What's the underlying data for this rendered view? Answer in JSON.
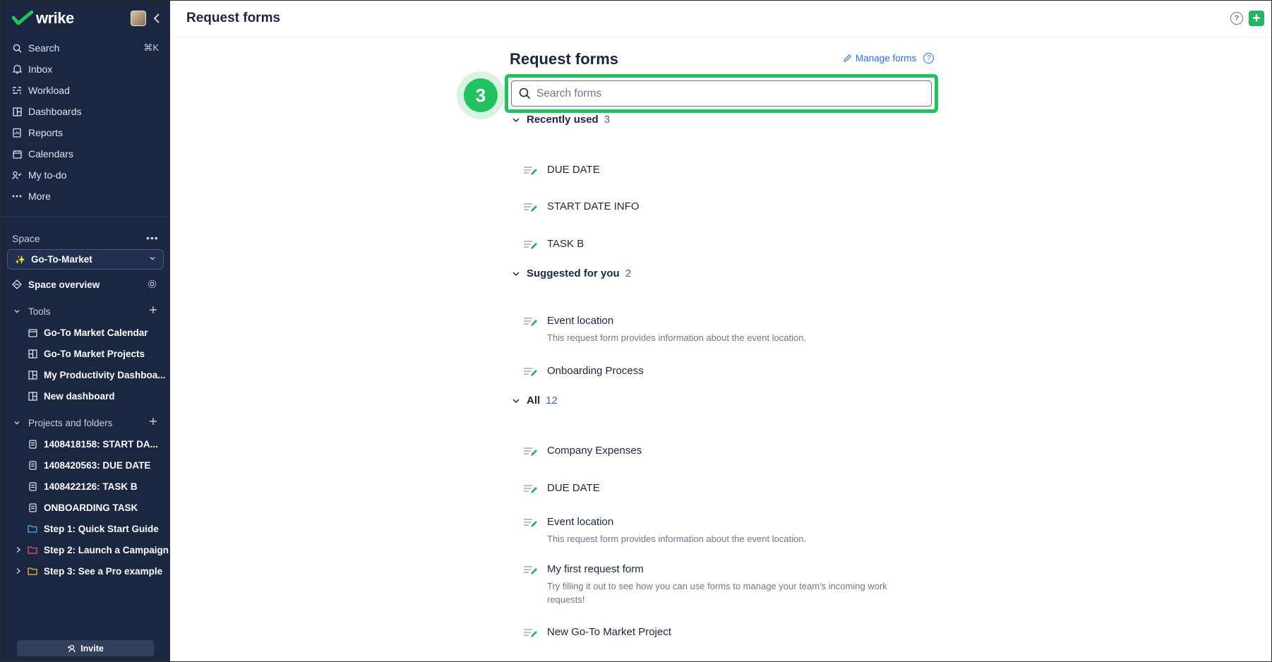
{
  "app": {
    "logo_text": "wrike",
    "colors": {
      "sidebar_bg": "#1b2640",
      "accent_green": "#22c261",
      "link_blue": "#2f6fd6"
    }
  },
  "sidebar": {
    "nav": [
      {
        "label": "Search",
        "icon": "search-icon",
        "shortcut": "⌘K"
      },
      {
        "label": "Inbox",
        "icon": "bell-icon"
      },
      {
        "label": "Workload",
        "icon": "workload-icon"
      },
      {
        "label": "Dashboards",
        "icon": "dashboard-icon"
      },
      {
        "label": "Reports",
        "icon": "report-icon"
      },
      {
        "label": "Calendars",
        "icon": "calendar-icon"
      },
      {
        "label": "My to-do",
        "icon": "todo-icon"
      },
      {
        "label": "More",
        "icon": "more-icon"
      }
    ],
    "space_label": "Space",
    "space_menu": "•••",
    "space_selected": "Go-To-Market",
    "space_overview": "Space overview",
    "tools_label": "Tools",
    "tools": [
      {
        "label": "Go-To Market Calendar",
        "icon": "calendar-icon"
      },
      {
        "label": "Go-To Market Projects",
        "icon": "board-icon"
      },
      {
        "label": "My Productivity Dashboa...",
        "icon": "dashboard-icon"
      },
      {
        "label": "New dashboard",
        "icon": "dashboard-icon"
      }
    ],
    "projects_label": "Projects and folders",
    "projects": [
      {
        "label": "1408418158: START DA...",
        "icon": "project-icon"
      },
      {
        "label": "1408420563: DUE DATE",
        "icon": "project-icon"
      },
      {
        "label": "1408422126: TASK B",
        "icon": "project-icon"
      },
      {
        "label": "ONBOARDING TASK",
        "icon": "project-icon"
      },
      {
        "label": "Step 1: Quick Start Guide",
        "icon": "folder-icon",
        "color": "#4fb3e8"
      },
      {
        "label": "Step 2: Launch a Campaign",
        "icon": "folder-icon",
        "color": "#e0566f"
      },
      {
        "label": "Step 3: See a Pro example",
        "icon": "folder-icon",
        "color": "#e8c23a"
      }
    ],
    "invite_label": "Invite"
  },
  "header": {
    "title": "Request forms"
  },
  "main": {
    "title": "Request forms",
    "manage_forms": "Manage forms",
    "step_number": "3",
    "search_placeholder": "Search forms",
    "sections": {
      "recent": {
        "label": "Recently used",
        "count": "3",
        "items": [
          {
            "name": "DUE DATE"
          },
          {
            "name": "START DATE INFO"
          },
          {
            "name": "TASK B"
          }
        ]
      },
      "suggested": {
        "label": "Suggested for you",
        "count": "2",
        "items": [
          {
            "name": "Event location",
            "desc": "This request form provides information about the event location."
          },
          {
            "name": "Onboarding Process"
          }
        ]
      },
      "all": {
        "label": "All",
        "count": "12",
        "items": [
          {
            "name": "Company Expenses"
          },
          {
            "name": "DUE DATE"
          },
          {
            "name": "Event location",
            "desc": "This request form provides information about the event location."
          },
          {
            "name": "My first request form",
            "desc": "Try filling it out to see how you can use forms to manage your team's incoming work requests!"
          },
          {
            "name": "New Go-To Market Project"
          }
        ]
      }
    }
  }
}
